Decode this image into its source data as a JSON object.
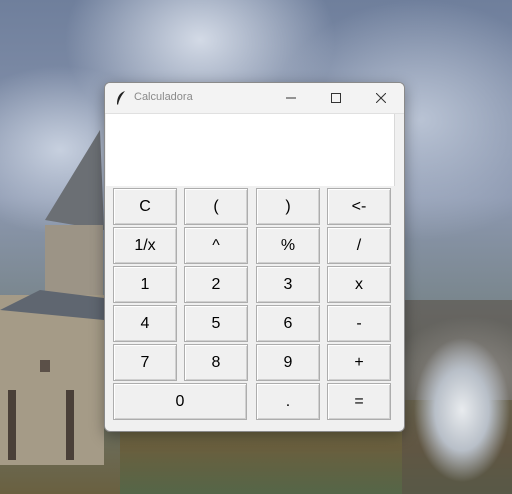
{
  "window": {
    "title": "Calculadora",
    "app_icon": "feather-icon",
    "controls": [
      "minimize-icon",
      "maximize-icon",
      "close-icon"
    ]
  },
  "display": {
    "value": ""
  },
  "keypad": {
    "rows": [
      [
        "C",
        "(",
        ")",
        "<-"
      ],
      [
        "1/x",
        "^",
        "%",
        "/"
      ],
      [
        "1",
        "2",
        "3",
        "x"
      ],
      [
        "4",
        "5",
        "6",
        "-"
      ],
      [
        "7",
        "8",
        "9",
        "+"
      ],
      [
        "0",
        ".",
        "="
      ]
    ]
  }
}
